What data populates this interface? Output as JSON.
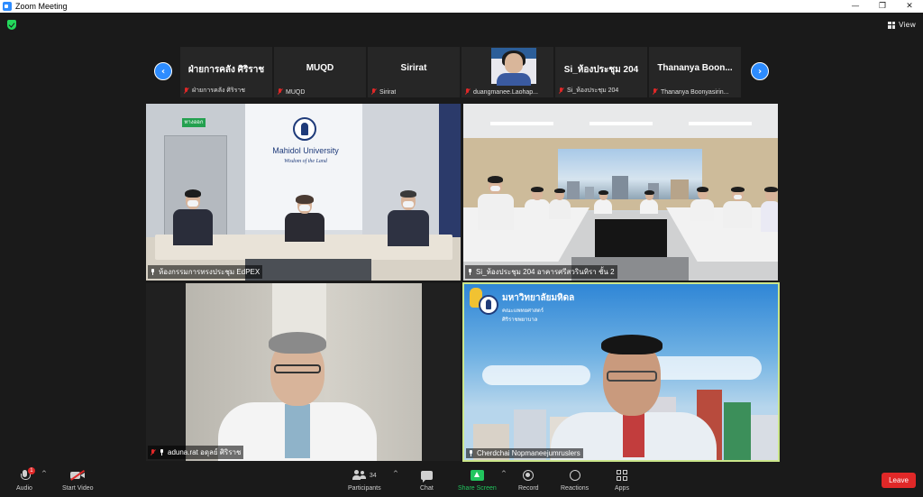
{
  "window": {
    "title": "Zoom Meeting",
    "minimize": "—",
    "maximize": "❐",
    "close": "✕"
  },
  "topbar": {
    "view_label": "View",
    "security_color": "#23d95b"
  },
  "thumbnails": [
    {
      "name": "ฝ่ายการคลัง ศิริราช",
      "label": "ฝ่ายการคลัง ศิริราช",
      "has_video": false,
      "muted": true
    },
    {
      "name": "MUQD",
      "label": "MUQD",
      "has_video": false,
      "muted": true
    },
    {
      "name": "Sirirat",
      "label": "Sirirat",
      "has_video": false,
      "muted": true
    },
    {
      "name": "",
      "label": "duangmanee.Laohap...",
      "has_video": true,
      "muted": true
    },
    {
      "name": "Si_ห้องประชุม 204",
      "label": "Si_ห้องประชุม 204",
      "has_video": false,
      "muted": true
    },
    {
      "name": "Thananya  Boon...",
      "label": "Thananya Boonyasirin...",
      "has_video": false,
      "muted": true
    }
  ],
  "nav": {
    "prev": "‹",
    "next": "›"
  },
  "tiles": [
    {
      "label": "ห้องกรรมการทรงประชุม EdPEX",
      "sign_title": "Mahidol University",
      "sign_subtitle": "Wisdom of the Land",
      "exit_sign": "ทางออก"
    },
    {
      "label": "Si_ห้องประชุม 204 อาคารศรีสวรินทิรา ชั้น 2"
    },
    {
      "label": "aduna.rat อดุลย์ ศิริราช"
    },
    {
      "label": "Cherdchai Nopmaneejumruslers",
      "org_line1": "มหาวิทยาลัยมหิดล",
      "org_line2": "คณะแพทยศาสตร์",
      "org_line3": "ศิริราชพยาบาล",
      "active_speaker_color": "#cbe68a",
      "raised_hand": true
    }
  ],
  "toolbar": {
    "audio": "Audio",
    "audio_badge": "1",
    "start_video": "Start Video",
    "participants": "Participants",
    "participants_count": "34",
    "chat": "Chat",
    "share_screen": "Share Screen",
    "record": "Record",
    "reactions": "Reactions",
    "apps": "Apps",
    "leave": "Leave",
    "caret": "^"
  }
}
